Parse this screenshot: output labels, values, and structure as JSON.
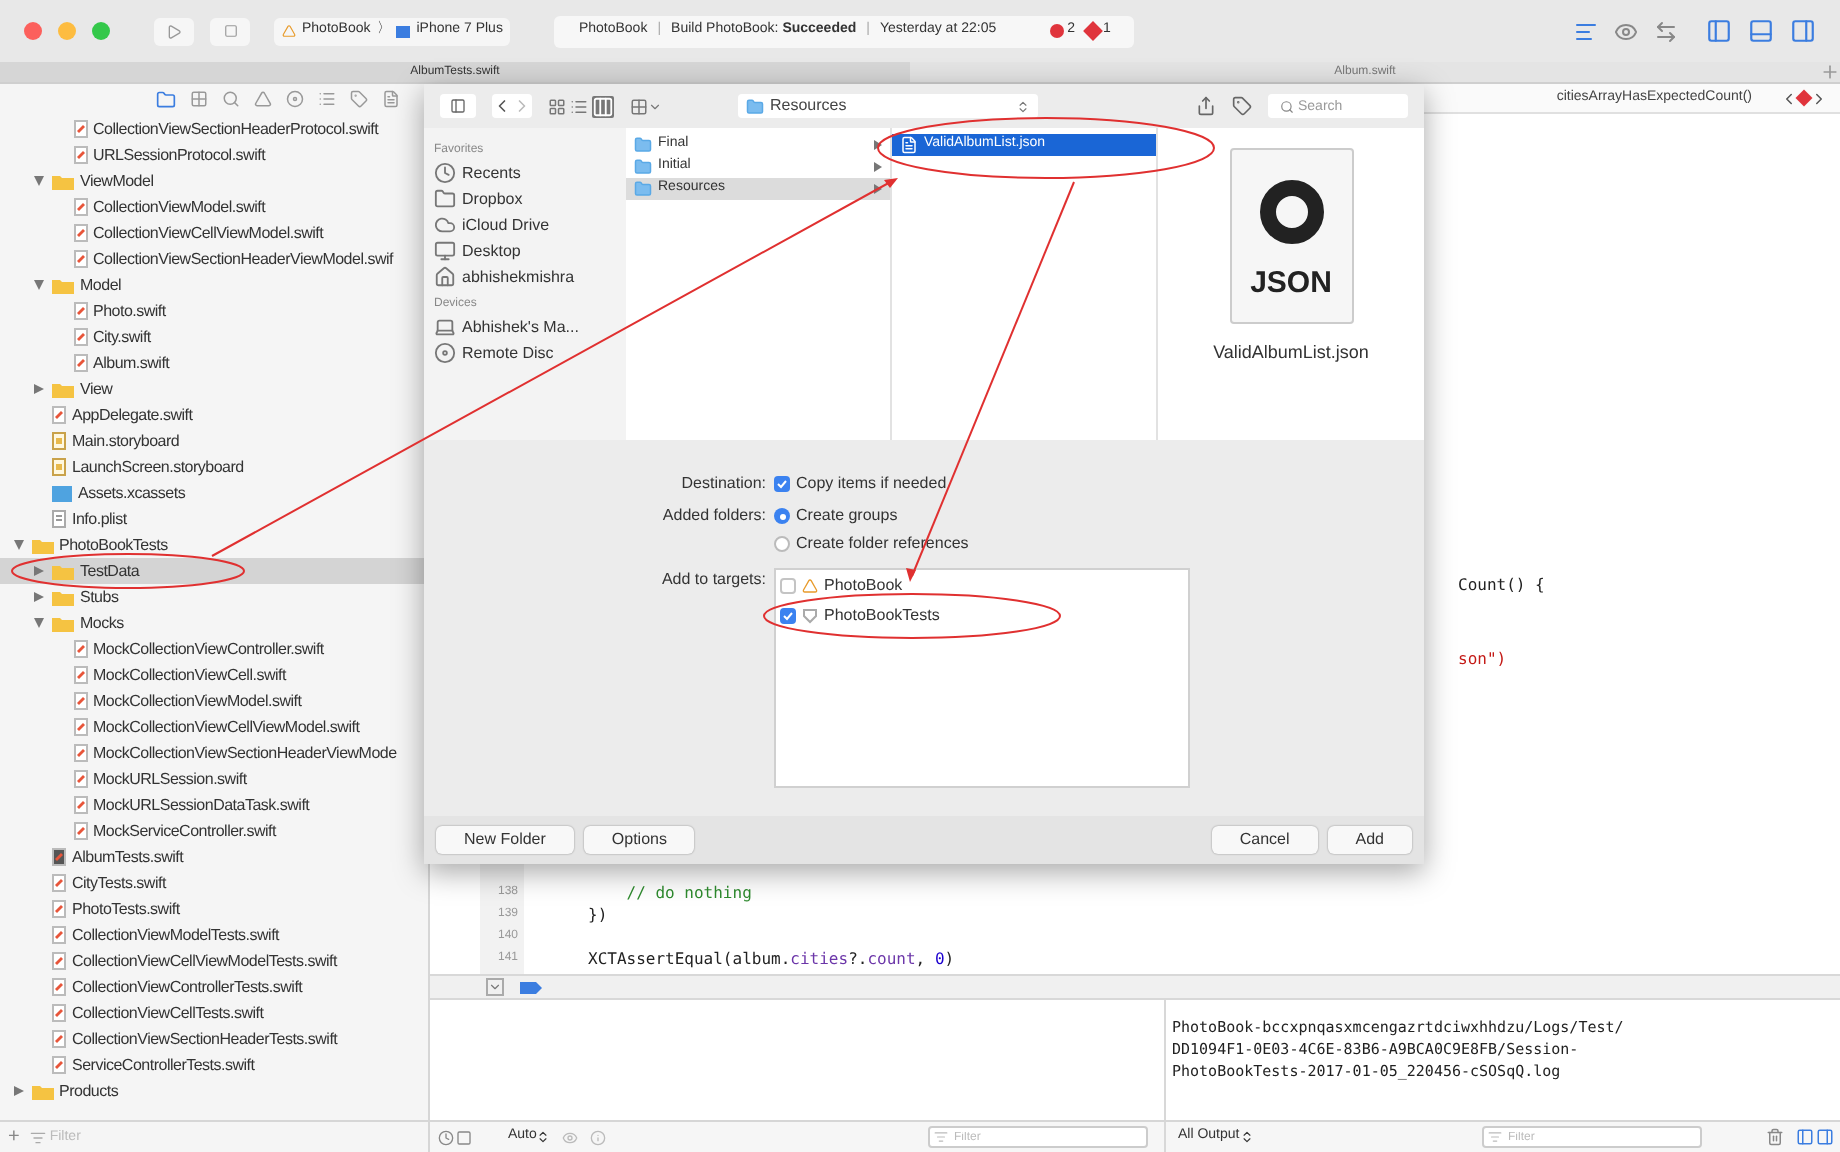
{
  "toolbar": {
    "scheme": {
      "project": "PhotoBook",
      "separator": "〉",
      "device": "iPhone 7 Plus"
    },
    "activity": [
      {
        "text": "PhotoBook",
        "kind": "text"
      },
      {
        "text": "|",
        "kind": "separator"
      },
      {
        "text": "Build PhotoBook: **Succeeded**",
        "kind": "text"
      },
      {
        "text": "|",
        "kind": "separator"
      },
      {
        "text": "Yesterday at 22:05",
        "kind": "text"
      }
    ],
    "issues": [
      {
        "kind": "error",
        "count": "2",
        "color": "#e0343c"
      },
      {
        "kind": "warning",
        "count": "1",
        "color": "#e0343c"
      }
    ]
  },
  "tabs": [
    {
      "label": "AlbumTests.swift",
      "selected": true
    },
    {
      "label": "Album.swift",
      "selected": false
    }
  ],
  "navigator": {
    "tree": [
      {
        "children": [
          {
            "children": [
              {
                "name": "CollectionViewSectionHeaderProtocol.swift",
                "kind": "swift",
                "selected": false
              },
              {
                "name": "URLSessionProtocol.swift",
                "kind": "swift",
                "selected": false
              }
            ]
          },
          {
            "name": "ViewModel",
            "kind": "folder",
            "expanded": true,
            "selected": false,
            "children": [
              {
                "name": "CollectionViewModel.swift",
                "kind": "swift",
                "selected": false
              },
              {
                "name": "CollectionViewCellViewModel.swift",
                "kind": "swift",
                "selected": false
              },
              {
                "name": "CollectionViewSectionHeaderViewModel.swif",
                "kind": "swift",
                "selected": false
              }
            ]
          },
          {
            "name": "Model",
            "kind": "folder",
            "expanded": true,
            "selected": false,
            "children": [
              {
                "name": "Photo.swift",
                "kind": "swift",
                "selected": false
              },
              {
                "name": "City.swift",
                "kind": "swift",
                "selected": false
              },
              {
                "name": "Album.swift",
                "kind": "swift",
                "selected": false
              }
            ]
          },
          {
            "name": "View",
            "kind": "folder",
            "expanded": false,
            "selected": false
          },
          {
            "name": "AppDelegate.swift",
            "kind": "swift",
            "selected": false
          },
          {
            "name": "Main.storyboard",
            "kind": "storyboard",
            "selected": false
          },
          {
            "name": "LaunchScreen.storyboard",
            "kind": "storyboard",
            "selected": false
          },
          {
            "name": "Assets.xcassets",
            "kind": "assets",
            "selected": false
          },
          {
            "name": "Info.plist",
            "kind": "plist",
            "selected": false
          }
        ]
      },
      {
        "name": "PhotoBookTests",
        "kind": "folder",
        "expanded": true,
        "selected": false,
        "children": [
          {
            "name": "TestData",
            "kind": "folder",
            "expanded": false,
            "selected": true
          },
          {
            "name": "Stubs",
            "kind": "folder",
            "expanded": false,
            "selected": false
          },
          {
            "name": "Mocks",
            "kind": "folder",
            "expanded": true,
            "selected": false,
            "children": [
              {
                "name": "MockCollectionViewController.swift",
                "kind": "swift",
                "selected": false
              },
              {
                "name": "MockCollectionViewCell.swift",
                "kind": "swift",
                "selected": false
              },
              {
                "name": "MockCollectionViewModel.swift",
                "kind": "swift",
                "selected": false
              },
              {
                "name": "MockCollectionViewCellViewModel.swift",
                "kind": "swift",
                "selected": false
              },
              {
                "name": "MockCollectionViewSectionHeaderViewMode",
                "kind": "swift",
                "selected": false
              },
              {
                "name": "MockURLSession.swift",
                "kind": "swift",
                "selected": false
              },
              {
                "name": "MockURLSessionDataTask.swift",
                "kind": "swift",
                "selected": false
              },
              {
                "name": "MockServiceController.swift",
                "kind": "swift",
                "selected": false
              }
            ]
          },
          {
            "name": "AlbumTests.swift",
            "kind": "swift-open",
            "selected": false
          },
          {
            "name": "CityTests.swift",
            "kind": "swift",
            "selected": false
          },
          {
            "name": "PhotoTests.swift",
            "kind": "swift",
            "selected": false
          },
          {
            "name": "CollectionViewModelTests.swift",
            "kind": "swift",
            "selected": false
          },
          {
            "name": "CollectionViewCellViewModelTests.swift",
            "kind": "swift",
            "selected": false
          },
          {
            "name": "CollectionViewControllerTests.swift",
            "kind": "swift",
            "selected": false
          },
          {
            "name": "CollectionViewCellTests.swift",
            "kind": "swift",
            "selected": false
          },
          {
            "name": "CollectionViewSectionHeaderTests.swift",
            "kind": "swift",
            "selected": false
          },
          {
            "name": "ServiceControllerTests.swift",
            "kind": "swift",
            "selected": false
          }
        ]
      },
      {
        "name": "Products",
        "kind": "folder",
        "expanded": false,
        "selected": false
      }
    ],
    "filter": {
      "add": "+",
      "placeholder": "Filter"
    }
  },
  "editor": {
    "jump_bar": "citiesArrayHasExpectedCount()",
    "fragments": [
      {
        "text": "Count() {",
        "kind": "plain"
      },
      {
        "text": "son\")",
        "kind": "string"
      }
    ],
    "lines": [
      {
        "number": "138",
        "segments": [
          {
            "text": "    // do nothing",
            "kind": "comment"
          }
        ]
      },
      {
        "number": "139",
        "segments": [
          {
            "text": "})",
            "kind": "plain"
          }
        ]
      },
      {
        "number": "140"
      },
      {
        "number": "141",
        "segments": [
          {
            "text": "XCTAssertEqual(album.",
            "kind": "plain"
          },
          {
            "text": "cities",
            "kind": "property"
          },
          {
            "text": "?.",
            "kind": "plain"
          },
          {
            "text": "count",
            "kind": "property"
          },
          {
            "text": ", ",
            "kind": "plain"
          },
          {
            "text": "0",
            "kind": "number"
          },
          {
            "text": ")",
            "kind": "plain"
          }
        ]
      }
    ]
  },
  "debug": {
    "console": [
      "PhotoBook-bccxpnqasxmcengazrtdciwxhhdzu/Logs/Test/",
      "DD1094F1-0E03-4C6E-83B6-A9BCA0C9E8FB/Session-",
      "PhotoBookTests-2017-01-05_220456-cSOSqQ.log"
    ],
    "scope": "Auto",
    "variables_filter": {
      "placeholder": "Filter"
    },
    "output": "All Output",
    "console_filter": {
      "placeholder": "Filter"
    }
  },
  "dialog": {
    "path": "Resources",
    "search_placeholder": "Search",
    "sidebar": [
      {
        "title": "Favorites",
        "items": [
          {
            "label": "Recents",
            "kind": "recents"
          },
          {
            "label": "Dropbox",
            "kind": "folder"
          },
          {
            "label": "iCloud Drive",
            "kind": "cloud"
          },
          {
            "label": "Desktop",
            "kind": "desktop"
          },
          {
            "label": "abhishekmishra",
            "kind": "home"
          }
        ]
      },
      {
        "title": "Devices",
        "items": [
          {
            "label": "Abhishek's Ma...",
            "kind": "laptop"
          },
          {
            "label": "Remote Disc",
            "kind": "disc"
          }
        ]
      }
    ],
    "columns": [
      {
        "active": false,
        "items": [
          {
            "name": "Final",
            "kind": "folder",
            "selected": false
          },
          {
            "name": "Initial",
            "kind": "folder",
            "selected": false
          },
          {
            "name": "Resources",
            "kind": "folder",
            "selected": true
          }
        ]
      },
      {
        "active": true,
        "items": [
          {
            "name": "ValidAlbumList.json",
            "kind": "json",
            "selected": true
          }
        ]
      }
    ],
    "preview": {
      "icon_label": "JSON",
      "name": "ValidAlbumList.json"
    },
    "destination": {
      "label": "Destination:",
      "option": "Copy items if needed",
      "checked": true
    },
    "added_folders": {
      "label": "Added folders:",
      "options": [
        {
          "label": "Create groups",
          "selected": true
        },
        {
          "label": "Create folder references",
          "selected": false
        }
      ]
    },
    "targets": {
      "label": "Add to targets:",
      "items": [
        {
          "name": "PhotoBook",
          "kind": "app",
          "checked": false
        },
        {
          "name": "PhotoBookTests",
          "kind": "tests",
          "checked": true
        }
      ]
    },
    "buttons": [
      {
        "label": "New Folder",
        "kind": "left"
      },
      {
        "label": "Options",
        "kind": "left"
      },
      {
        "label": "Cancel",
        "kind": "right"
      },
      {
        "label": "Add",
        "kind": "right"
      }
    ]
  }
}
